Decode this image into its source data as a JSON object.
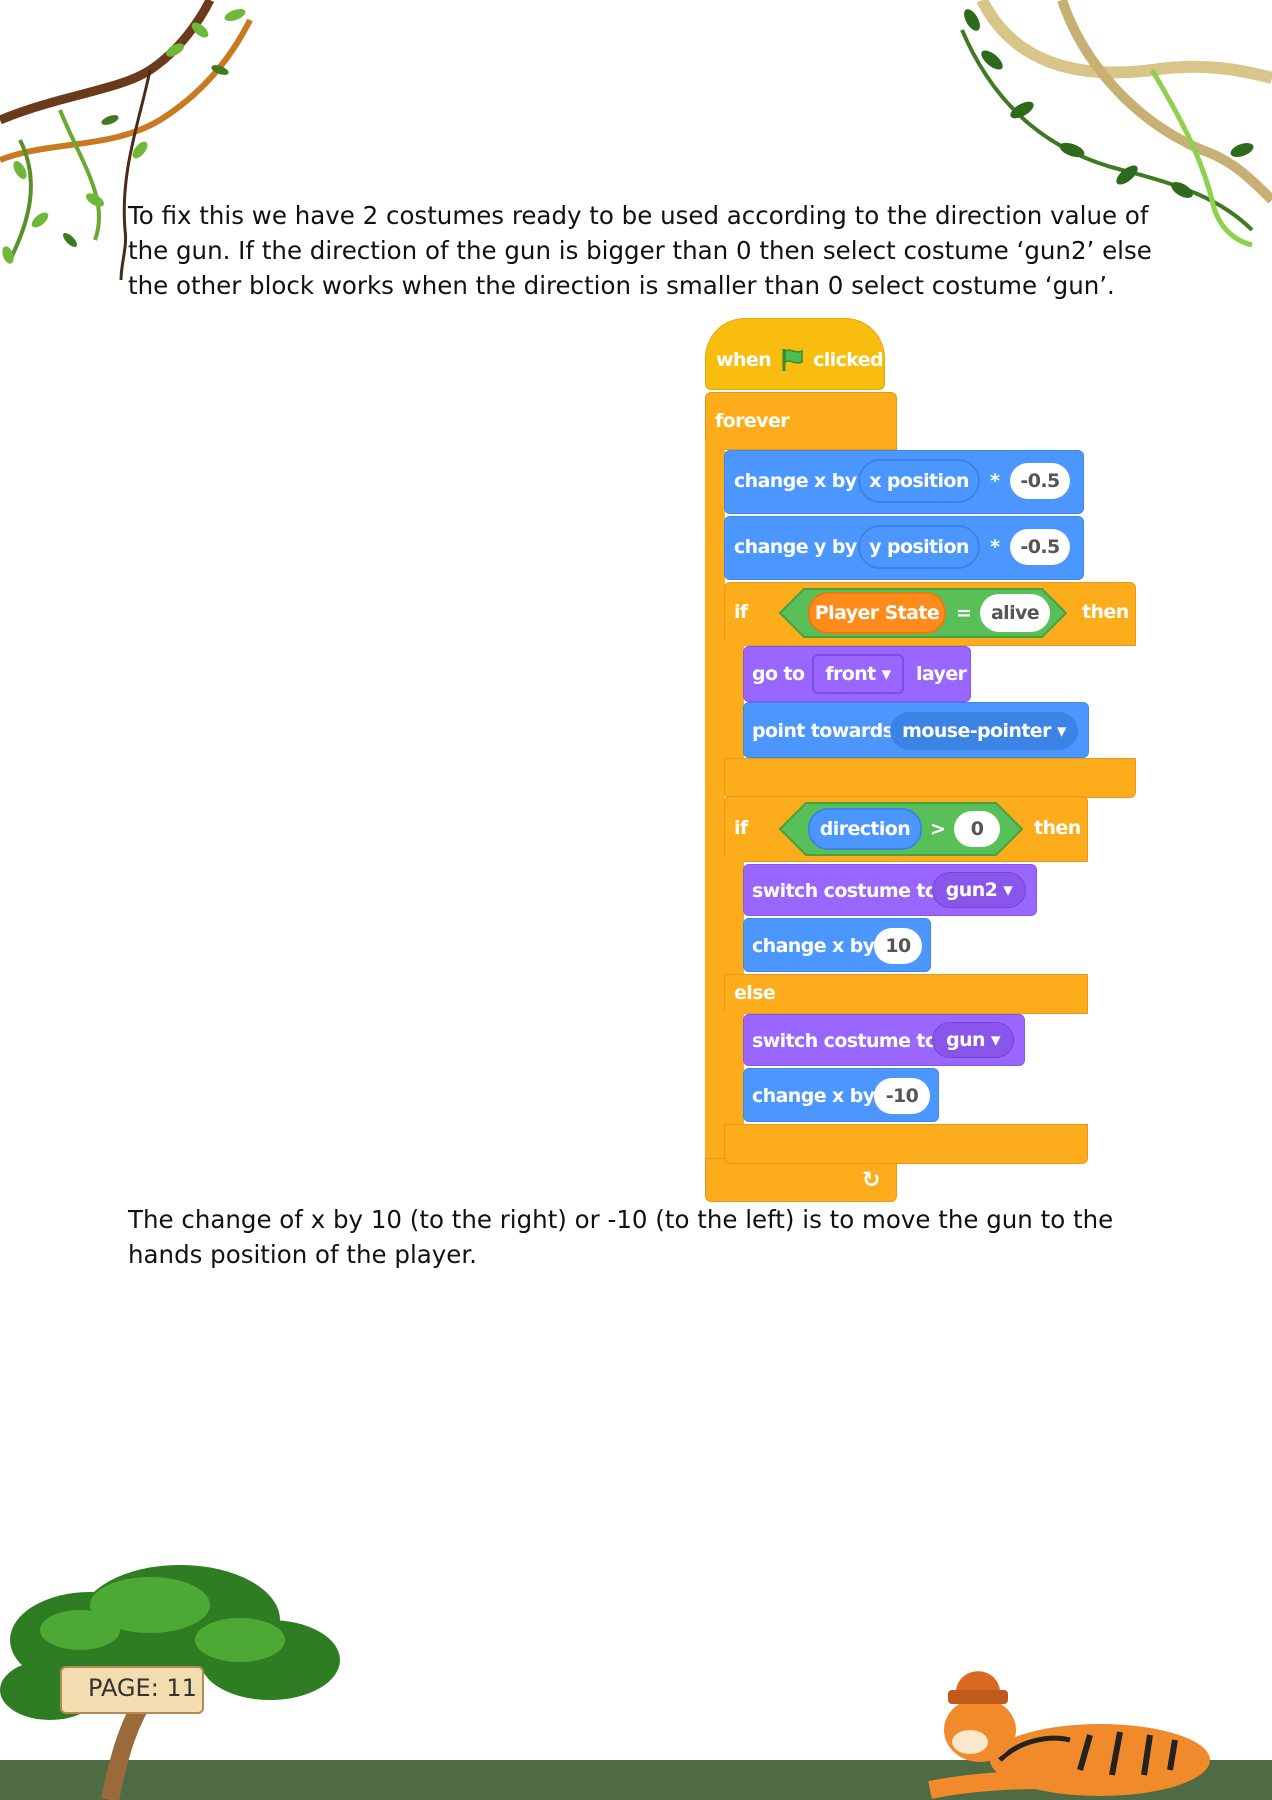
{
  "paragraph1": [
    "To fix this we have 2 costumes ready to be used according to the direction value of",
    "the gun. If the direction of the gun is bigger than 0 then select costume ‘gun2’ else",
    "the other block works when the direction is smaller than 0 select costume  ‘gun’."
  ],
  "paragraph2": [
    "The change of x by 10 (to the right) or -10 (to the left) is to move the gun to the",
    "hands position of the player."
  ],
  "scratch": {
    "hat": {
      "when": "when",
      "clicked": "clicked"
    },
    "forever": "forever",
    "change_x": {
      "label": "change x by",
      "reporter": "x position",
      "op": "*",
      "value": "-0.5"
    },
    "change_y": {
      "label": "change y by",
      "reporter": "y position",
      "op": "*",
      "value": "-0.5"
    },
    "if1": {
      "if": "if",
      "variable": "Player State",
      "op": "=",
      "value": "alive",
      "then": "then"
    },
    "goto": {
      "label": "go to",
      "menu": "front ▾",
      "suffix": "layer"
    },
    "point": {
      "label": "point towards",
      "menu": "mouse-pointer ▾"
    },
    "if2": {
      "if": "if",
      "reporter": "direction",
      "op": ">",
      "value": "0",
      "then": "then"
    },
    "switch1": {
      "label": "switch costume to",
      "menu": "gun2 ▾"
    },
    "changex1": {
      "label": "change x by",
      "value": "10"
    },
    "else": "else",
    "switch2": {
      "label": "switch costume to",
      "menu": "gun ▾"
    },
    "changex2": {
      "label": "change x by",
      "value": "-10"
    },
    "loop_arrow": "↻"
  },
  "page_label": "PAGE: 11",
  "colors": {
    "ground": "#4f6b44",
    "events": "#f8bd0f",
    "control": "#fdac1c",
    "motion": "#4c97ff",
    "looks": "#9966ff",
    "operators": "#59c059",
    "variables": "#ff8c1a"
  }
}
